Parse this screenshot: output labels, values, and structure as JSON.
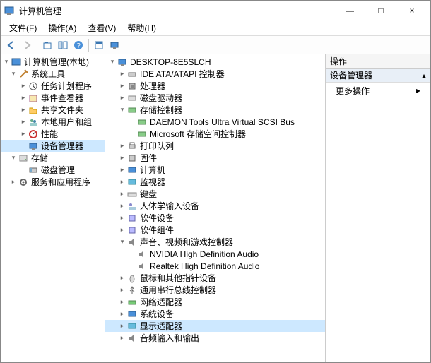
{
  "window": {
    "title": "计算机管理",
    "controls": {
      "min": "—",
      "max": "□",
      "close": "×"
    }
  },
  "menubar": {
    "file": "文件(F)",
    "action": "操作(A)",
    "view": "查看(V)",
    "help": "帮助(H)"
  },
  "toolbar_icons": {
    "back": "back",
    "forward": "forward",
    "up": "up",
    "show_hide": "show_hide",
    "help": "help",
    "refresh": "refresh",
    "monitor": "monitor"
  },
  "left_tree": {
    "root": "计算机管理(本地)",
    "system_tools": "系统工具",
    "task_scheduler": "任务计划程序",
    "event_viewer": "事件查看器",
    "shared_folders": "共享文件夹",
    "local_users": "本地用户和组",
    "performance": "性能",
    "device_manager": "设备管理器",
    "storage": "存储",
    "disk_mgmt": "磁盘管理",
    "services": "服务和应用程序"
  },
  "mid_tree": {
    "root": "DESKTOP-8E5SLCH",
    "ide": "IDE ATA/ATAPI 控制器",
    "cpu": "处理器",
    "disk_drive": "磁盘驱动器",
    "storage_ctrl": "存储控制器",
    "daemon": "DAEMON Tools Ultra Virtual SCSI Bus",
    "ms_storage": "Microsoft 存储空间控制器",
    "print_queue": "打印队列",
    "firmware": "固件",
    "computer": "计算机",
    "monitor": "监视器",
    "keyboard": "键盘",
    "hid": "人体学输入设备",
    "software_dev": "软件设备",
    "software_comp": "软件组件",
    "sound": "声音、视频和游戏控制器",
    "nvidia_audio": "NVIDIA High Definition Audio",
    "realtek_audio": "Realtek High Definition Audio",
    "mouse": "鼠标和其他指针设备",
    "usb": "通用串行总线控制器",
    "network": "网络适配器",
    "system_dev": "系统设备",
    "display": "显示适配器",
    "audio_io": "音频输入和输出"
  },
  "actions": {
    "header": "操作",
    "category": "设备管理器",
    "more": "更多操作"
  }
}
